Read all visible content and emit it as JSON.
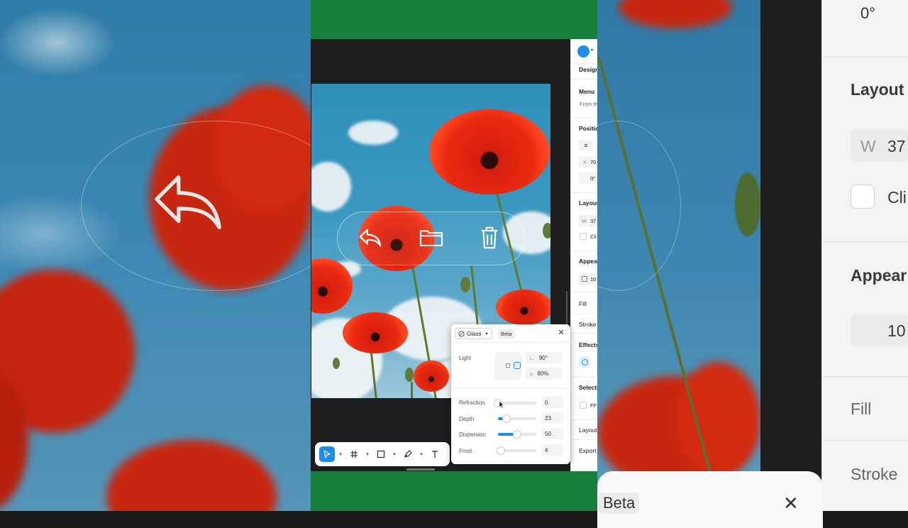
{
  "sidebar": {
    "tab": "Design",
    "menu_title": "Menu",
    "menu_sub": "From th",
    "position_label": "Positio",
    "x_prefix": "X",
    "x_value": "70",
    "rotation_value": "0°",
    "layout_label": "Layout",
    "w_prefix": "W",
    "w_value": "37",
    "clip_label": "Cli",
    "appearance_label": "Appea",
    "opacity_value": "10",
    "fill_label": "Fill",
    "stroke_label": "Stroke",
    "effects_label": "Effects",
    "selection_label": "Selectio",
    "selection_color": "FF",
    "layout_guide_label": "Layout",
    "export_label": "Export",
    "accent_color": "#1d8cf1"
  },
  "popup": {
    "effect_type": "Glass",
    "badge": "Beta",
    "light_label": "Light",
    "light_angle": "90°",
    "light_intensity": "80%",
    "refraction_label": "Refraction",
    "refraction_value": "0",
    "depth_label": "Depth",
    "depth_value": "23",
    "dispersion_label": "Dispersion",
    "dispersion_value": "50",
    "frost_label": "Frost",
    "frost_value": "4"
  },
  "background": {
    "rotation_value": "0°",
    "layout_label": "Layout",
    "w_prefix": "W",
    "w_value": "37",
    "clip_label": "Cli",
    "appearance_label": "Appear",
    "opacity_value": "10",
    "fill_label": "Fill",
    "stroke_label": "Stroke",
    "badge": "Beta"
  },
  "colors": {
    "frame_green": "#177f3c",
    "poppy_red": "#ea2a10",
    "sky_blue": "#3a98c1"
  }
}
